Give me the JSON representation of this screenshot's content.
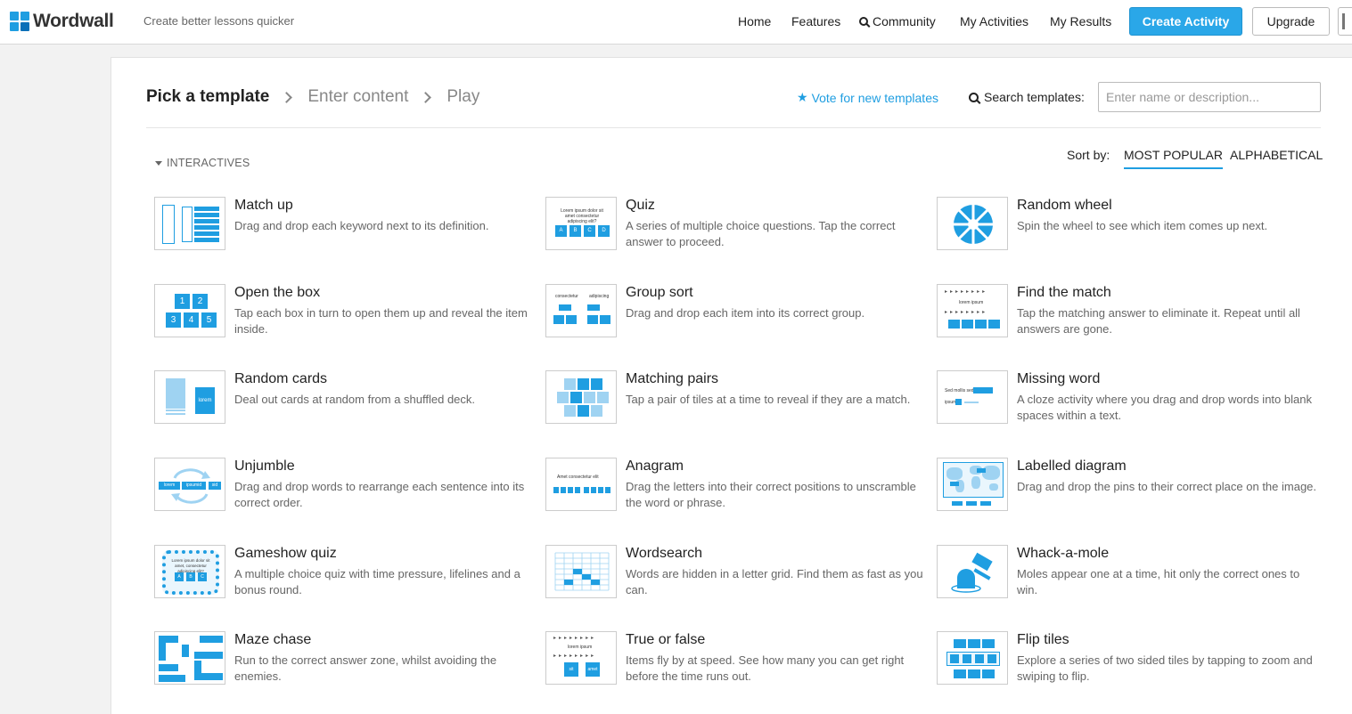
{
  "header": {
    "logo_text": "Wordwall",
    "tagline": "Create better lessons quicker",
    "nav": {
      "home": "Home",
      "features": "Features",
      "community": "Community",
      "my_activities": "My Activities",
      "my_results": "My Results"
    },
    "create_label": "Create Activity",
    "upgrade_label": "Upgrade"
  },
  "steps": {
    "pick": "Pick a template",
    "enter": "Enter content",
    "play": "Play"
  },
  "vote_label": "Vote for new templates",
  "search": {
    "label": "Search templates:",
    "placeholder": "Enter name or description..."
  },
  "section": "INTERACTIVES",
  "sort": {
    "label": "Sort by:",
    "most_popular": "MOST POPULAR",
    "alphabetical": "ALPHABETICAL",
    "selected": "most_popular"
  },
  "accent_color": "#1f9ee1",
  "templates": [
    {
      "name": "Match up",
      "desc": "Drag and drop each keyword next to its definition.",
      "icon": "match-up-icon"
    },
    {
      "name": "Quiz",
      "desc": "A series of multiple choice questions. Tap the correct answer to proceed.",
      "icon": "quiz-icon"
    },
    {
      "name": "Random wheel",
      "desc": "Spin the wheel to see which item comes up next.",
      "icon": "random-wheel-icon"
    },
    {
      "name": "Open the box",
      "desc": "Tap each box in turn to open them up and reveal the item inside.",
      "icon": "open-the-box-icon"
    },
    {
      "name": "Group sort",
      "desc": "Drag and drop each item into its correct group.",
      "icon": "group-sort-icon"
    },
    {
      "name": "Find the match",
      "desc": "Tap the matching answer to eliminate it. Repeat until all answers are gone.",
      "icon": "find-the-match-icon"
    },
    {
      "name": "Random cards",
      "desc": "Deal out cards at random from a shuffled deck.",
      "icon": "random-cards-icon"
    },
    {
      "name": "Matching pairs",
      "desc": "Tap a pair of tiles at a time to reveal if they are a match.",
      "icon": "matching-pairs-icon"
    },
    {
      "name": "Missing word",
      "desc": "A cloze activity where you drag and drop words into blank spaces within a text.",
      "icon": "missing-word-icon"
    },
    {
      "name": "Unjumble",
      "desc": "Drag and drop words to rearrange each sentence into its correct order.",
      "icon": "unjumble-icon"
    },
    {
      "name": "Anagram",
      "desc": "Drag the letters into their correct positions to unscramble the word or phrase.",
      "icon": "anagram-icon"
    },
    {
      "name": "Labelled diagram",
      "desc": "Drag and drop the pins to their correct place on the image.",
      "icon": "labelled-diagram-icon"
    },
    {
      "name": "Gameshow quiz",
      "desc": "A multiple choice quiz with time pressure, lifelines and a bonus round.",
      "icon": "gameshow-quiz-icon"
    },
    {
      "name": "Wordsearch",
      "desc": "Words are hidden in a letter grid. Find them as fast as you can.",
      "icon": "wordsearch-icon"
    },
    {
      "name": "Whack-a-mole",
      "desc": "Moles appear one at a time, hit only the correct ones to win.",
      "icon": "whack-a-mole-icon"
    },
    {
      "name": "Maze chase",
      "desc": "Run to the correct answer zone, whilst avoiding the enemies.",
      "icon": "maze-chase-icon"
    },
    {
      "name": "True or false",
      "desc": "Items fly by at speed. See how many you can get right before the time runs out.",
      "icon": "true-or-false-icon"
    },
    {
      "name": "Flip tiles",
      "desc": "Explore a series of two sided tiles by tapping to zoom and swiping to flip.",
      "icon": "flip-tiles-icon"
    }
  ],
  "thumb_text": {
    "quiz_question": "Lorem ipsum dolor sit amet consectetur adipiscing elit?",
    "quiz_options": [
      "A",
      "B",
      "C",
      "D"
    ],
    "boxes": [
      "1",
      "2",
      "3",
      "4",
      "5"
    ],
    "group_left": "consectetur",
    "group_right": "adipiscing",
    "find_word": "lorem ipsum",
    "card_word": "lorem",
    "missing_line1": "Sed mollis sed at",
    "missing_line2": "ipsum",
    "unjumble_words": [
      "lorem",
      "ipsumid",
      "sid"
    ],
    "anagram_word": "Amet consectetur elit",
    "gameshow_question": "Lorem ipsum dolor sit amet, consectetur adipiscing elit?",
    "gameshow_options": [
      "A",
      "B",
      "C"
    ],
    "truefalse_word": "lorem ipsum",
    "truefalse_options": [
      "sit",
      "amet"
    ]
  }
}
